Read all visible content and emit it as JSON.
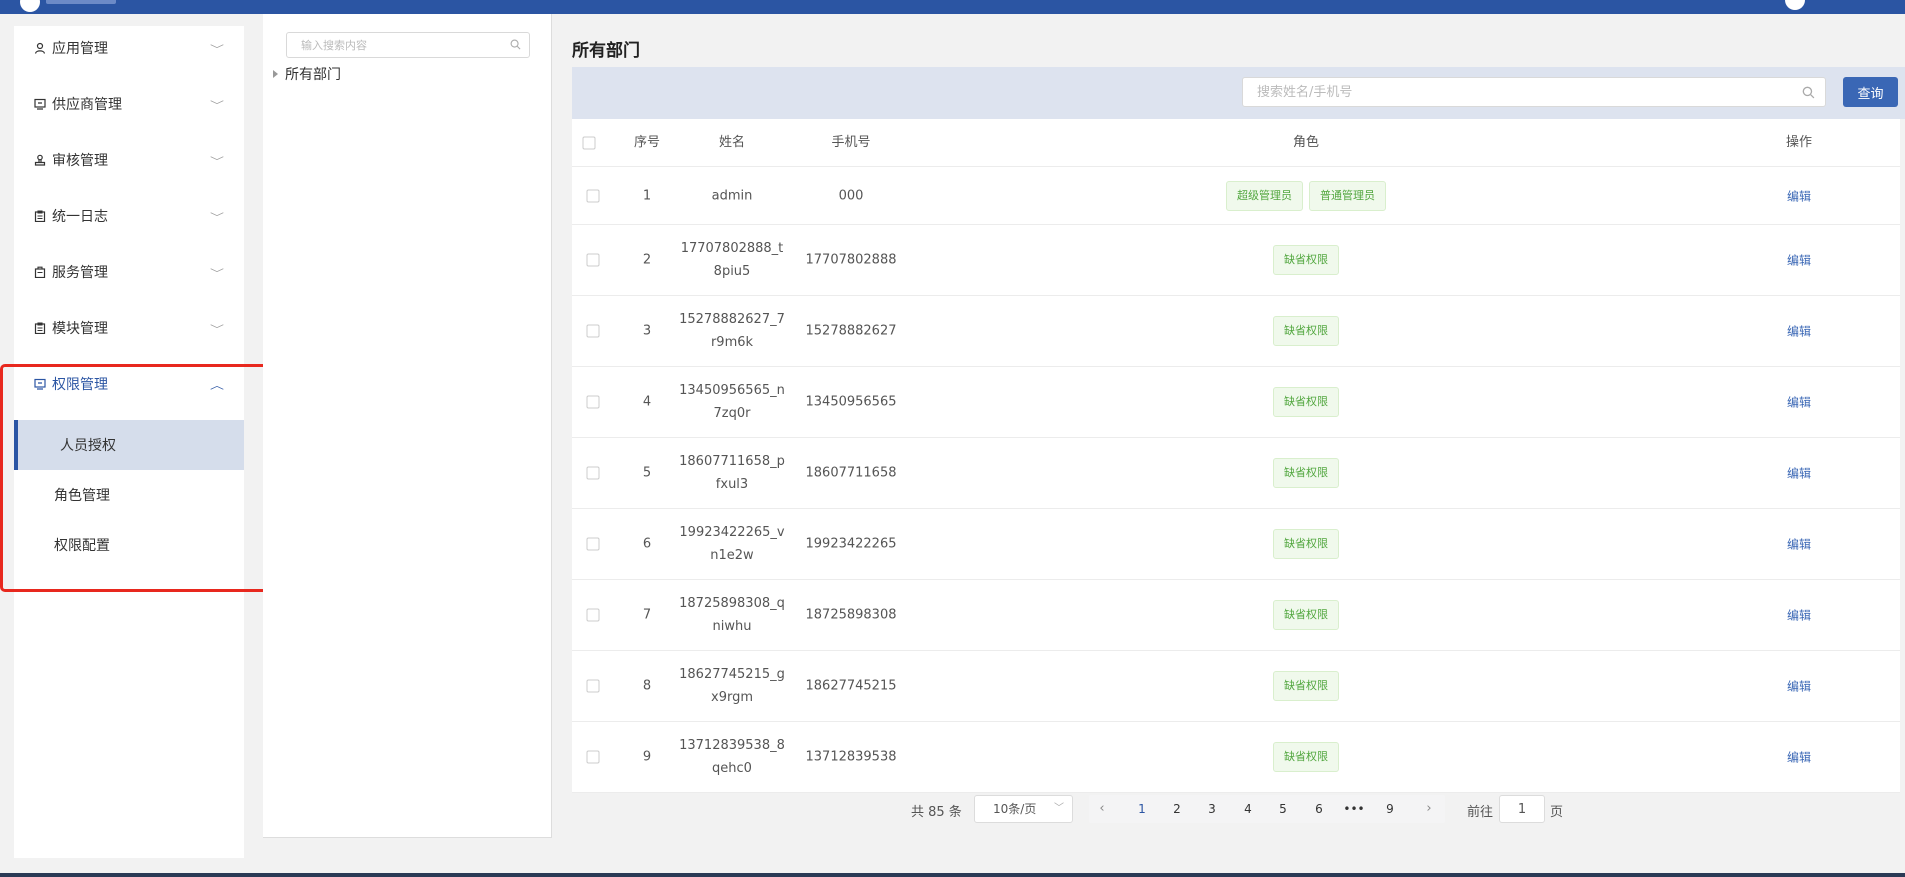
{
  "sidebar": {
    "items": [
      {
        "label": "应用管理",
        "icon": "user-icon"
      },
      {
        "label": "供应商管理",
        "icon": "monitor-icon"
      },
      {
        "label": "审核管理",
        "icon": "stamp-icon"
      },
      {
        "label": "统一日志",
        "icon": "clipboard-icon"
      },
      {
        "label": "服务管理",
        "icon": "briefcase-icon"
      },
      {
        "label": "模块管理",
        "icon": "clipboard-icon"
      },
      {
        "label": "权限管理",
        "icon": "monitor-icon"
      }
    ],
    "sub_items": [
      {
        "label": "人员授权",
        "selected": true
      },
      {
        "label": "角色管理",
        "selected": false
      },
      {
        "label": "权限配置",
        "selected": false
      }
    ]
  },
  "dept_panel": {
    "search_placeholder": "输入搜索内容",
    "tree_root": "所有部门"
  },
  "main": {
    "title": "所有部门",
    "search_placeholder": "搜索姓名/手机号",
    "query_label": "查询",
    "columns": [
      "序号",
      "姓名",
      "手机号",
      "角色",
      "操作"
    ],
    "rows": [
      {
        "index": "1",
        "name": "admin",
        "phone": "000",
        "roles": [
          "超级管理员",
          "普通管理员"
        ],
        "action": "编辑"
      },
      {
        "index": "2",
        "name": "17707802888_t8piu5",
        "phone": "17707802888",
        "roles": [
          "缺省权限"
        ],
        "action": "编辑"
      },
      {
        "index": "3",
        "name": "15278882627_7r9m6k",
        "phone": "15278882627",
        "roles": [
          "缺省权限"
        ],
        "action": "编辑"
      },
      {
        "index": "4",
        "name": "13450956565_n7zq0r",
        "phone": "13450956565",
        "roles": [
          "缺省权限"
        ],
        "action": "编辑"
      },
      {
        "index": "5",
        "name": "18607711658_pfxul3",
        "phone": "18607711658",
        "roles": [
          "缺省权限"
        ],
        "action": "编辑"
      },
      {
        "index": "6",
        "name": "19923422265_vn1e2w",
        "phone": "19923422265",
        "roles": [
          "缺省权限"
        ],
        "action": "编辑"
      },
      {
        "index": "7",
        "name": "18725898308_qniwhu",
        "phone": "18725898308",
        "roles": [
          "缺省权限"
        ],
        "action": "编辑"
      },
      {
        "index": "8",
        "name": "18627745215_gx9rgm",
        "phone": "18627745215",
        "roles": [
          "缺省权限"
        ],
        "action": "编辑"
      },
      {
        "index": "9",
        "name": "13712839538_8qehc0",
        "phone": "13712839538",
        "roles": [
          "缺省权限"
        ],
        "action": "编辑"
      }
    ]
  },
  "pagination": {
    "total": "共 85 条",
    "page_size": "10条/页",
    "pages": [
      "1",
      "2",
      "3",
      "4",
      "5",
      "6",
      "•••",
      "9"
    ],
    "current_page": "1",
    "goto_label": "前往",
    "goto_value": "1",
    "goto_unit": "页"
  },
  "colors": {
    "primary": "#2b55a3",
    "highlight": "#e8281e",
    "tag_text": "#52a73f",
    "tag_bg": "#f0f9ec"
  }
}
